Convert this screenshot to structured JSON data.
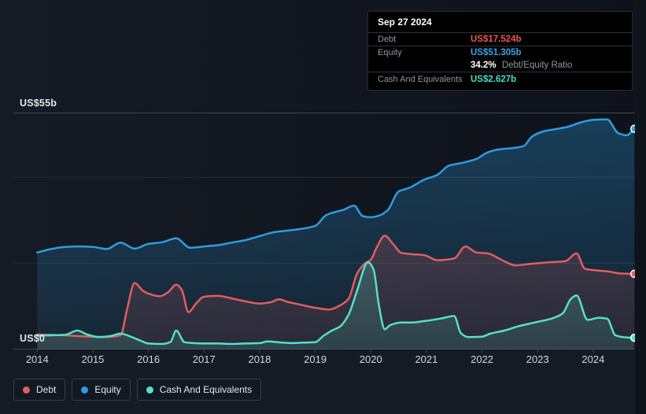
{
  "colors": {
    "debt": "#e15d5d",
    "equity": "#2f9ce0",
    "cash": "#53e2c5",
    "debt_value_text": "#f05252",
    "equity_value_text": "#3aa3ec",
    "cash_value_text": "#45ddc8",
    "grid_major": "#40464f",
    "grid_minor": "#252b34",
    "panel_bg": "#151b24",
    "page_bg": "#0f131a",
    "tooltip_bg": "#000000",
    "marker_ring": "#ffffff"
  },
  "tooltip": {
    "date": "Sep 27 2024",
    "debt_label": "Debt",
    "debt_value": "US$17.524b",
    "equity_label": "Equity",
    "equity_value": "US$51.305b",
    "ratio_value": "34.2%",
    "ratio_label": "Debt/Equity Ratio",
    "cash_label": "Cash And Equivalents",
    "cash_value": "US$2.627b"
  },
  "legend": {
    "items": [
      {
        "key": "debt",
        "label": "Debt",
        "color": "#e15d5d"
      },
      {
        "key": "equity",
        "label": "Equity",
        "color": "#2f9ce0"
      },
      {
        "key": "cash",
        "label": "Cash And Equivalents",
        "color": "#53e2c5"
      }
    ]
  },
  "y_axis": {
    "top_label": "US$55b",
    "zero_label": "US$0"
  },
  "x_axis": {
    "years": [
      "2014",
      "2015",
      "2016",
      "2017",
      "2018",
      "2019",
      "2020",
      "2021",
      "2022",
      "2023",
      "2024"
    ]
  },
  "chart_data": {
    "type": "area",
    "title": "",
    "xlabel": "",
    "ylabel": "US$ billions",
    "x_domain": [
      2014,
      2024.74
    ],
    "ylim": [
      0,
      55
    ],
    "gridline_values": [
      0,
      20,
      40,
      55
    ],
    "labeled_gridlines": [
      0,
      55
    ],
    "legend_position": "bottom-left",
    "draw_order": [
      "equity",
      "debt",
      "cash"
    ],
    "end_markers": true,
    "series": [
      {
        "key": "equity",
        "name": "Equity",
        "color": "#2f9ce0",
        "points": [
          [
            2014.0,
            22.5
          ],
          [
            2014.25,
            23.3
          ],
          [
            2014.5,
            23.8
          ],
          [
            2014.75,
            23.9
          ],
          [
            2015.0,
            23.8
          ],
          [
            2015.25,
            23.3
          ],
          [
            2015.5,
            24.8
          ],
          [
            2015.75,
            23.4
          ],
          [
            2016.0,
            24.5
          ],
          [
            2016.25,
            24.9
          ],
          [
            2016.5,
            25.8
          ],
          [
            2016.75,
            23.6
          ],
          [
            2017.0,
            23.9
          ],
          [
            2017.25,
            24.2
          ],
          [
            2017.5,
            24.8
          ],
          [
            2017.75,
            25.4
          ],
          [
            2018.0,
            26.3
          ],
          [
            2018.25,
            27.2
          ],
          [
            2018.5,
            27.6
          ],
          [
            2018.75,
            28.0
          ],
          [
            2019.0,
            28.7
          ],
          [
            2019.2,
            31.2
          ],
          [
            2019.35,
            31.9
          ],
          [
            2019.5,
            32.4
          ],
          [
            2019.7,
            33.4
          ],
          [
            2019.85,
            31.0
          ],
          [
            2020.0,
            30.7
          ],
          [
            2020.15,
            31.1
          ],
          [
            2020.3,
            32.3
          ],
          [
            2020.5,
            36.7
          ],
          [
            2020.7,
            37.6
          ],
          [
            2020.95,
            39.4
          ],
          [
            2021.2,
            40.6
          ],
          [
            2021.4,
            42.7
          ],
          [
            2021.65,
            43.4
          ],
          [
            2021.9,
            44.3
          ],
          [
            2022.1,
            45.8
          ],
          [
            2022.3,
            46.5
          ],
          [
            2022.6,
            46.9
          ],
          [
            2022.75,
            47.3
          ],
          [
            2022.9,
            49.5
          ],
          [
            2023.1,
            50.7
          ],
          [
            2023.35,
            51.3
          ],
          [
            2023.55,
            51.8
          ],
          [
            2023.8,
            52.9
          ],
          [
            2024.0,
            53.4
          ],
          [
            2024.25,
            53.5
          ],
          [
            2024.45,
            50.3
          ],
          [
            2024.6,
            49.8
          ],
          [
            2024.74,
            51.305
          ]
        ]
      },
      {
        "key": "debt",
        "name": "Debt",
        "color": "#e15d5d",
        "points": [
          [
            2014.0,
            3.4
          ],
          [
            2014.25,
            3.3
          ],
          [
            2014.5,
            3.2
          ],
          [
            2014.75,
            3.0
          ],
          [
            2015.0,
            2.9
          ],
          [
            2015.25,
            2.8
          ],
          [
            2015.5,
            3.2
          ],
          [
            2015.62,
            9.5
          ],
          [
            2015.75,
            15.4
          ],
          [
            2015.9,
            13.6
          ],
          [
            2016.0,
            12.9
          ],
          [
            2016.2,
            12.3
          ],
          [
            2016.35,
            13.2
          ],
          [
            2016.5,
            15.0
          ],
          [
            2016.6,
            13.8
          ],
          [
            2016.72,
            8.6
          ],
          [
            2016.85,
            10.5
          ],
          [
            2017.0,
            12.2
          ],
          [
            2017.25,
            12.4
          ],
          [
            2017.5,
            11.8
          ],
          [
            2017.75,
            11.1
          ],
          [
            2018.0,
            10.6
          ],
          [
            2018.2,
            10.9
          ],
          [
            2018.35,
            11.6
          ],
          [
            2018.5,
            11.0
          ],
          [
            2018.75,
            10.3
          ],
          [
            2019.0,
            9.6
          ],
          [
            2019.25,
            9.2
          ],
          [
            2019.45,
            10.2
          ],
          [
            2019.6,
            11.7
          ],
          [
            2019.75,
            17.5
          ],
          [
            2019.9,
            20.0
          ],
          [
            2020.0,
            20.8
          ],
          [
            2020.1,
            23.5
          ],
          [
            2020.25,
            26.4
          ],
          [
            2020.4,
            24.5
          ],
          [
            2020.55,
            22.4
          ],
          [
            2020.75,
            22.1
          ],
          [
            2020.95,
            21.9
          ],
          [
            2021.2,
            20.7
          ],
          [
            2021.5,
            21.1
          ],
          [
            2021.7,
            23.9
          ],
          [
            2021.9,
            22.5
          ],
          [
            2022.1,
            22.3
          ],
          [
            2022.35,
            20.8
          ],
          [
            2022.6,
            19.5
          ],
          [
            2022.9,
            19.9
          ],
          [
            2023.2,
            20.2
          ],
          [
            2023.5,
            20.5
          ],
          [
            2023.7,
            22.3
          ],
          [
            2023.85,
            18.7
          ],
          [
            2024.0,
            18.4
          ],
          [
            2024.25,
            18.1
          ],
          [
            2024.5,
            17.6
          ],
          [
            2024.74,
            17.524
          ]
        ]
      },
      {
        "key": "cash",
        "name": "Cash And Equivalents",
        "color": "#53e2c5",
        "points": [
          [
            2014.0,
            3.1
          ],
          [
            2014.25,
            3.2
          ],
          [
            2014.5,
            3.3
          ],
          [
            2014.72,
            4.3
          ],
          [
            2014.9,
            3.4
          ],
          [
            2015.1,
            2.8
          ],
          [
            2015.3,
            3.0
          ],
          [
            2015.5,
            3.6
          ],
          [
            2015.7,
            2.8
          ],
          [
            2015.85,
            2.0
          ],
          [
            2016.0,
            1.3
          ],
          [
            2016.25,
            1.2
          ],
          [
            2016.4,
            1.7
          ],
          [
            2016.5,
            4.3
          ],
          [
            2016.65,
            1.6
          ],
          [
            2016.8,
            1.4
          ],
          [
            2017.0,
            1.3
          ],
          [
            2017.25,
            1.3
          ],
          [
            2017.5,
            1.2
          ],
          [
            2017.75,
            1.3
          ],
          [
            2018.0,
            1.4
          ],
          [
            2018.15,
            1.8
          ],
          [
            2018.4,
            1.5
          ],
          [
            2018.6,
            1.4
          ],
          [
            2018.8,
            1.5
          ],
          [
            2019.0,
            1.6
          ],
          [
            2019.15,
            3.1
          ],
          [
            2019.3,
            4.3
          ],
          [
            2019.45,
            5.3
          ],
          [
            2019.6,
            8.0
          ],
          [
            2019.75,
            13.5
          ],
          [
            2019.95,
            20.2
          ],
          [
            2020.05,
            18.5
          ],
          [
            2020.15,
            9.8
          ],
          [
            2020.25,
            4.6
          ],
          [
            2020.35,
            5.6
          ],
          [
            2020.55,
            6.2
          ],
          [
            2020.75,
            6.2
          ],
          [
            2020.95,
            6.5
          ],
          [
            2021.25,
            7.1
          ],
          [
            2021.5,
            7.7
          ],
          [
            2021.62,
            3.7
          ],
          [
            2021.75,
            2.8
          ],
          [
            2022.0,
            2.9
          ],
          [
            2022.15,
            3.6
          ],
          [
            2022.4,
            4.3
          ],
          [
            2022.65,
            5.3
          ],
          [
            2022.95,
            6.2
          ],
          [
            2023.25,
            7.1
          ],
          [
            2023.45,
            8.3
          ],
          [
            2023.6,
            11.7
          ],
          [
            2023.7,
            12.5
          ],
          [
            2023.9,
            6.8
          ],
          [
            2024.1,
            7.3
          ],
          [
            2024.25,
            7.1
          ],
          [
            2024.4,
            3.2
          ],
          [
            2024.6,
            2.7
          ],
          [
            2024.74,
            2.627
          ]
        ]
      }
    ]
  }
}
